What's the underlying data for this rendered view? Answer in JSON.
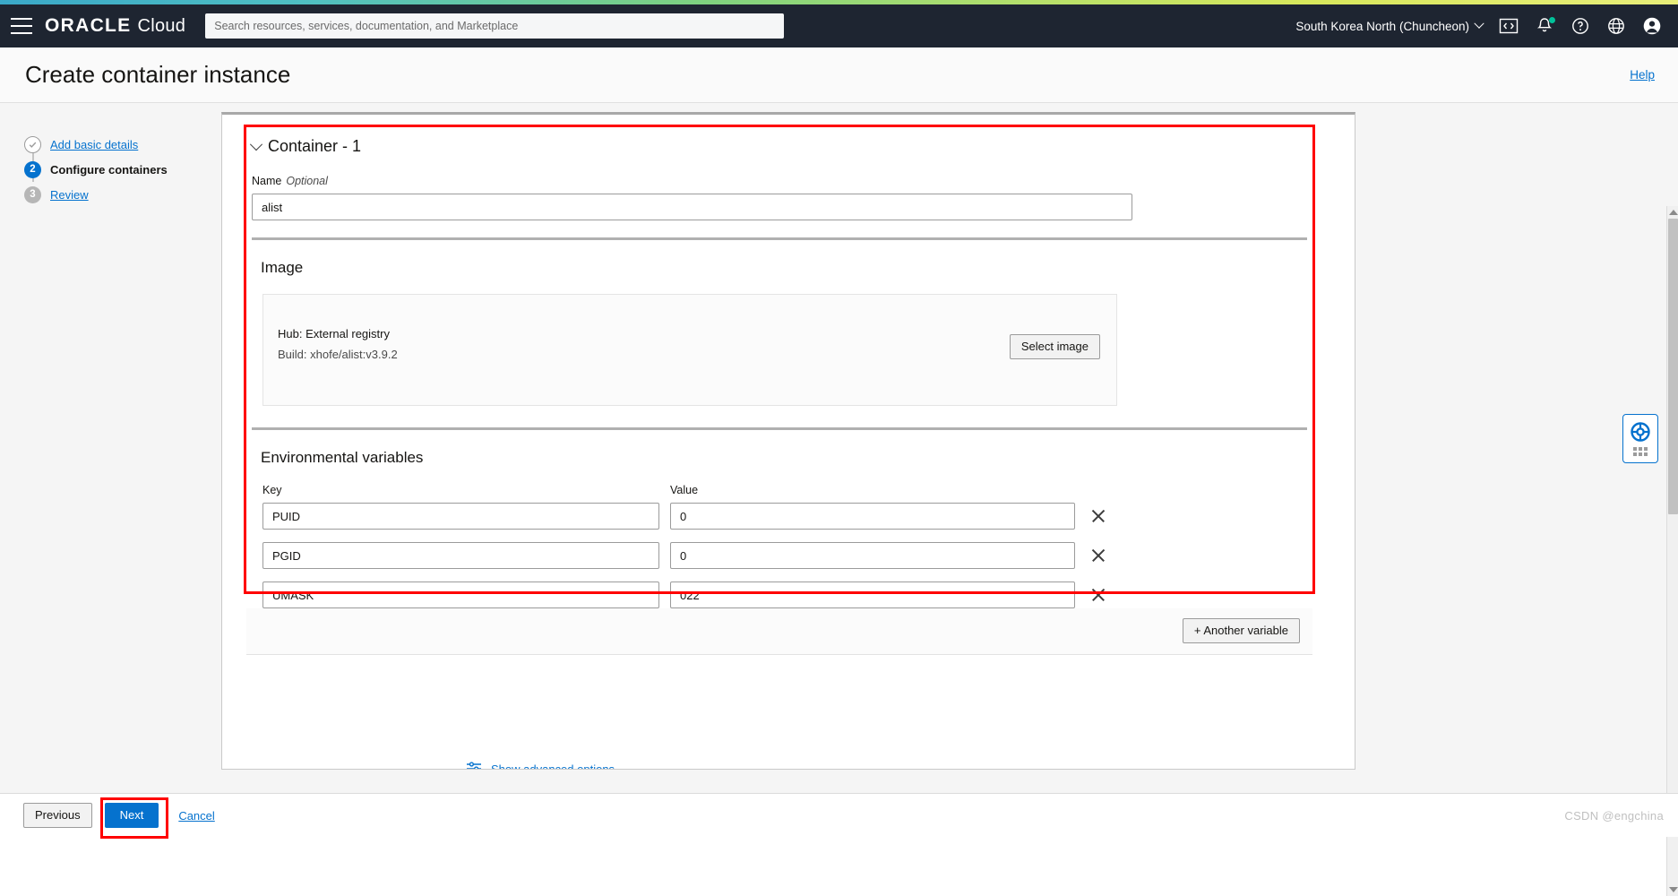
{
  "header": {
    "brand_primary": "ORACLE",
    "brand_secondary": "Cloud",
    "search_placeholder": "Search resources, services, documentation, and Marketplace",
    "region": "South Korea North (Chuncheon)",
    "icons": [
      "menu-icon",
      "code-editor-icon",
      "notifications-bell-icon",
      "help-question-icon",
      "language-globe-icon",
      "user-avatar-icon"
    ]
  },
  "titlebar": {
    "title": "Create container instance",
    "help_label": "Help"
  },
  "wizard": {
    "steps": [
      {
        "number": "",
        "label": "Add basic details",
        "state": "done"
      },
      {
        "number": "2",
        "label": "Configure containers",
        "state": "current"
      },
      {
        "number": "3",
        "label": "Review",
        "state": "todo"
      }
    ]
  },
  "container": {
    "heading": "Container - 1",
    "name_label": "Name",
    "name_optional": "Optional",
    "name_value": "alist",
    "image": {
      "section_title": "Image",
      "hub_line": "Hub: External registry",
      "build_line": "Build: xhofe/alist:v3.9.2",
      "select_button": "Select image"
    },
    "env": {
      "section_title": "Environmental variables",
      "key_header": "Key",
      "value_header": "Value",
      "rows": [
        {
          "key": "PUID",
          "value": "0"
        },
        {
          "key": "PGID",
          "value": "0"
        },
        {
          "key": "UMASK",
          "value": "022"
        }
      ],
      "add_button": "+ Another variable"
    },
    "advanced_link": "Show advanced options"
  },
  "footer": {
    "previous": "Previous",
    "next": "Next",
    "cancel": "Cancel",
    "watermark": "CSDN @engchina"
  },
  "colors": {
    "accent_blue": "#0572ce",
    "header_bg": "#1e2531",
    "highlight_red": "#ff0000",
    "notification_dot": "#00c29a"
  }
}
